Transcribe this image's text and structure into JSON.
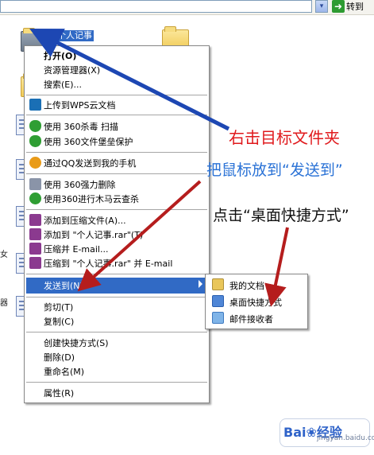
{
  "topbar": {
    "go_label": "转到",
    "dropdown_glyph": "▾",
    "go_glyph": "➜"
  },
  "desktop": {
    "selected_folder_label": "个人记事",
    "edge_texts": [
      "女",
      "器"
    ]
  },
  "context_menu": {
    "items": [
      {
        "label": "打开(O)",
        "icon": "none"
      },
      {
        "label": "资源管理器(X)",
        "icon": "none"
      },
      {
        "label": "搜索(E)...",
        "icon": "none"
      },
      {
        "label": "上传到WPS云文档",
        "icon": "wps-cloud-icon",
        "color": "#1a6fb5"
      },
      {
        "label": "使用 360杀毒 扫描",
        "icon": "shield-360-icon",
        "color": "#2f9e33"
      },
      {
        "label": "使用 360文件堡垒保护",
        "icon": "shield-360-icon",
        "color": "#2f9e33"
      },
      {
        "label": "通过QQ发送到我的手机",
        "icon": "qq-icon",
        "color": "#e99b18"
      },
      {
        "label": "使用 360强力删除",
        "icon": "delete-360-icon",
        "color": "#8a94a8"
      },
      {
        "label": "使用360进行木马云查杀",
        "icon": "trojan-360-icon",
        "color": "#2f9e33"
      },
      {
        "label": "添加到压缩文件(A)...",
        "icon": "winrar-icon",
        "color": "#8b3a8f"
      },
      {
        "label": "添加到 \"个人记事.rar\"(T)",
        "icon": "winrar-icon",
        "color": "#8b3a8f"
      },
      {
        "label": "压缩并 E-mail...",
        "icon": "winrar-icon",
        "color": "#8b3a8f"
      },
      {
        "label": "压缩到 \"个人记事.rar\" 并 E-mail",
        "icon": "winrar-icon",
        "color": "#8b3a8f"
      },
      {
        "label": "发送到(N)",
        "icon": "none",
        "highlighted": true
      },
      {
        "label": "剪切(T)",
        "icon": "none"
      },
      {
        "label": "复制(C)",
        "icon": "none"
      },
      {
        "label": "创建快捷方式(S)",
        "icon": "none"
      },
      {
        "label": "删除(D)",
        "icon": "none"
      },
      {
        "label": "重命名(M)",
        "icon": "none"
      },
      {
        "label": "属性(R)",
        "icon": "none"
      }
    ]
  },
  "sendto_menu": {
    "items": [
      {
        "label": "我的文档",
        "icon": "my-documents-icon"
      },
      {
        "label": "桌面快捷方式",
        "icon": "desktop-shortcut-icon"
      },
      {
        "label": "邮件接收者",
        "icon": "mail-recipient-icon"
      }
    ]
  },
  "annotations": {
    "step1": "右击目标文件夹",
    "step2": "把鼠标放到“发送到”",
    "step3": "点击“桌面快捷方式”"
  },
  "watermark": {
    "logo": "Bai❀经验",
    "sub": "jingyan.baidu.com"
  },
  "colors": {
    "arrow_blue": "#1d47b3",
    "arrow_red": "#b51d1d",
    "highlight": "#316ac5"
  }
}
